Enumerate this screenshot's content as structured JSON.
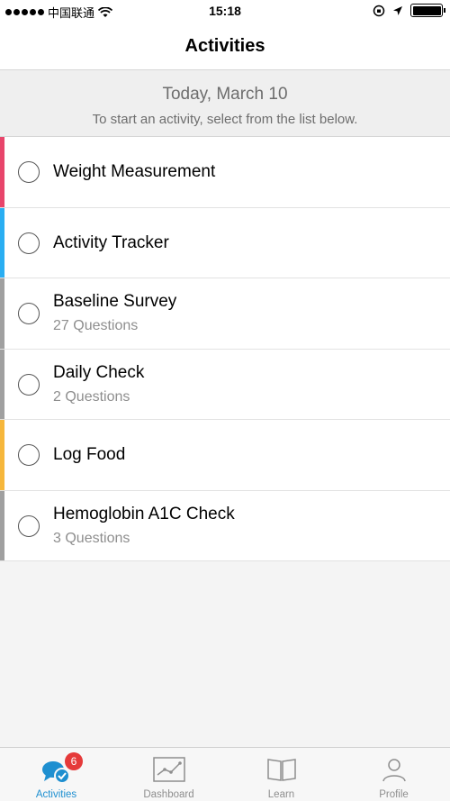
{
  "status_bar": {
    "carrier": "中国联通",
    "time": "15:18"
  },
  "nav": {
    "title": "Activities"
  },
  "header": {
    "date": "Today, March 10",
    "instruction": "To start an activity, select from the list below."
  },
  "activities": [
    {
      "title": "Weight Measurement",
      "subtitle": "",
      "color": "#e8456b"
    },
    {
      "title": "Activity Tracker",
      "subtitle": "",
      "color": "#2aaef2"
    },
    {
      "title": "Baseline Survey",
      "subtitle": "27 Questions",
      "color": "#a0a0a0"
    },
    {
      "title": "Daily Check",
      "subtitle": "2 Questions",
      "color": "#a0a0a0"
    },
    {
      "title": "Log Food",
      "subtitle": "",
      "color": "#f6b73c"
    },
    {
      "title": "Hemoglobin A1C Check",
      "subtitle": "3 Questions",
      "color": "#a0a0a0"
    }
  ],
  "tabs": [
    {
      "label": "Activities",
      "icon": "chat-bubbles-icon",
      "badge": "6",
      "active": true
    },
    {
      "label": "Dashboard",
      "icon": "chart-icon",
      "active": false
    },
    {
      "label": "Learn",
      "icon": "book-icon",
      "active": false
    },
    {
      "label": "Profile",
      "icon": "profile-icon",
      "active": false
    }
  ],
  "colors": {
    "accent": "#1e8fd0",
    "badge": "#e53a3a"
  }
}
